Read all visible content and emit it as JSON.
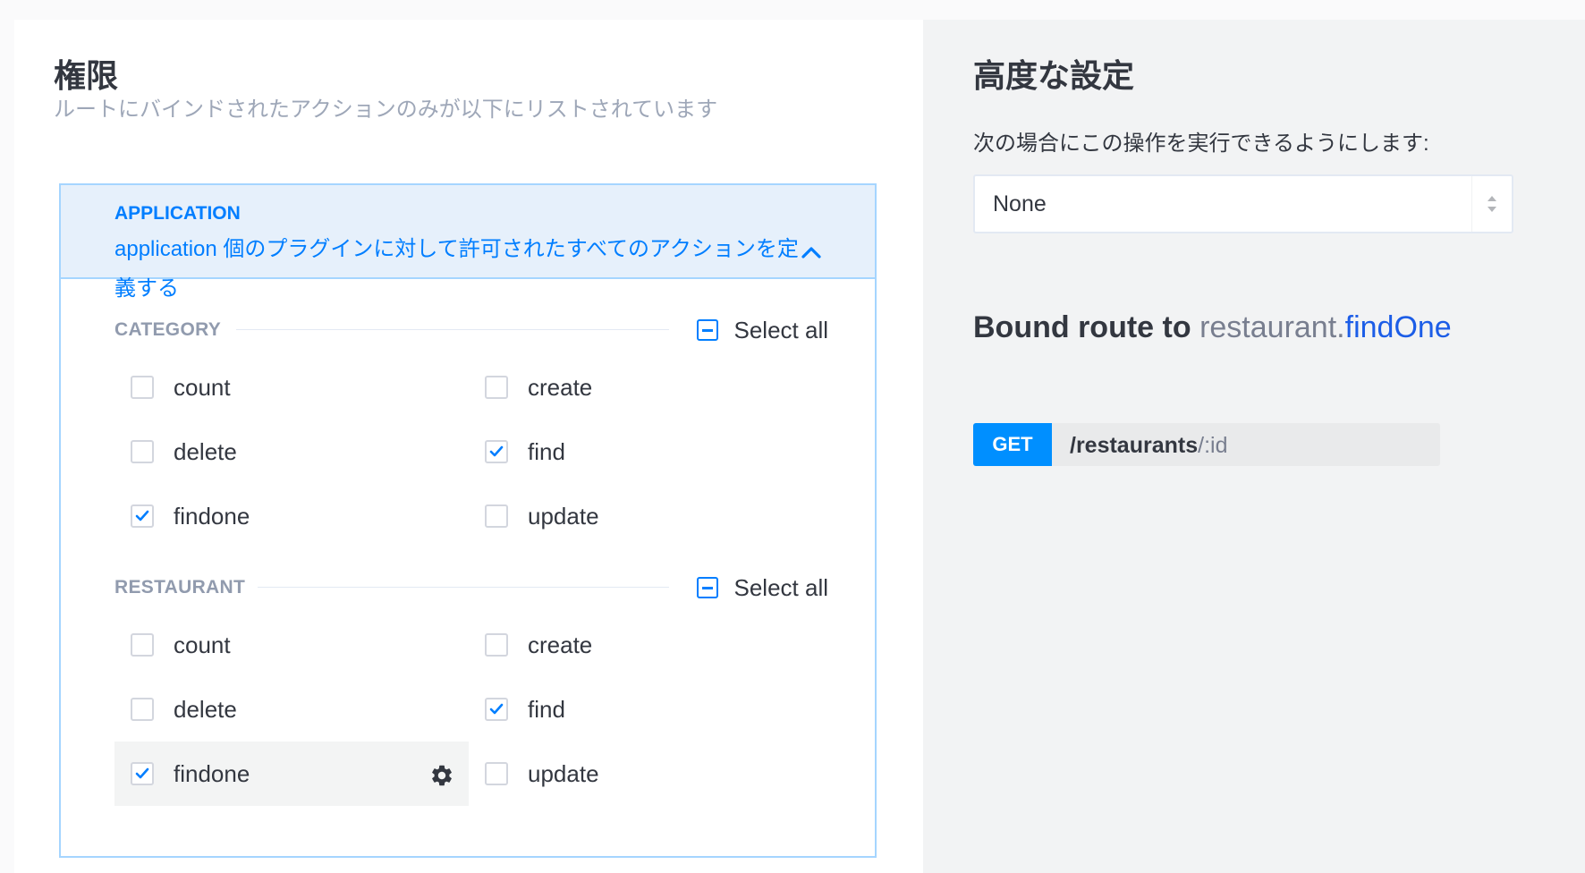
{
  "permissions": {
    "title": "権限",
    "subtitle": "ルートにバインドされたアクションのみが以下にリストされています",
    "plugin": {
      "name": "APPLICATION",
      "description": "application 個のプラグインに対して許可されたすべてのアクションを定義する",
      "expanded": true,
      "categories": [
        {
          "label": "CATEGORY",
          "select_all_label": "Select all",
          "select_all_state": "indeterminate",
          "actions": [
            {
              "label": "count",
              "checked": false
            },
            {
              "label": "create",
              "checked": false
            },
            {
              "label": "delete",
              "checked": false
            },
            {
              "label": "find",
              "checked": true
            },
            {
              "label": "findone",
              "checked": true
            },
            {
              "label": "update",
              "checked": false
            }
          ]
        },
        {
          "label": "RESTAURANT",
          "select_all_label": "Select all",
          "select_all_state": "indeterminate",
          "actions": [
            {
              "label": "count",
              "checked": false
            },
            {
              "label": "create",
              "checked": false
            },
            {
              "label": "delete",
              "checked": false
            },
            {
              "label": "find",
              "checked": true
            },
            {
              "label": "findone",
              "checked": true,
              "selected": true
            },
            {
              "label": "update",
              "checked": false
            }
          ]
        }
      ]
    }
  },
  "advanced": {
    "title": "高度な設定",
    "policy_label": "次の場合にこの操作を実行できるようにします:",
    "policy_value": "None",
    "bound_route": {
      "prefix": "Bound route to",
      "plugin": "restaurant",
      "dot": ".",
      "action": "findOne",
      "verb": "GET",
      "path_base": "/restaurants",
      "path_param": "/:id"
    }
  },
  "colors": {
    "accent": "#007eff",
    "verb": "#008fff",
    "action_link": "#1c5de7"
  }
}
